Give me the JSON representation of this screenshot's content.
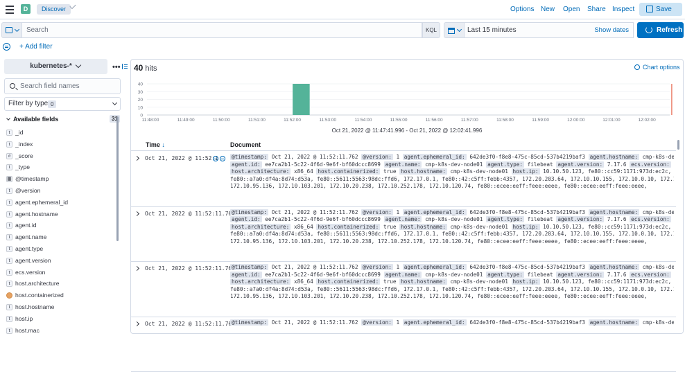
{
  "header": {
    "space_initial": "D",
    "breadcrumb": "Discover",
    "menu": [
      "Options",
      "New",
      "Open",
      "Share",
      "Inspect"
    ],
    "save_label": "Save"
  },
  "query": {
    "search_placeholder": "Search",
    "language": "KQL",
    "time_range": "Last 15 minutes",
    "show_dates": "Show dates",
    "refresh_label": "Refresh",
    "add_filter": "+ Add filter"
  },
  "sidebar": {
    "index_pattern": "kubernetes-*",
    "field_search_placeholder": "Search field names",
    "filter_by_type": "Filter by type",
    "filter_count": "0",
    "available_fields_label": "Available fields",
    "available_count": "31",
    "fields": [
      {
        "type": "t",
        "name": "_id"
      },
      {
        "type": "t",
        "name": "_index"
      },
      {
        "type": "#",
        "name": "_score"
      },
      {
        "type": "t",
        "name": "_type"
      },
      {
        "type": "date",
        "name": "@timestamp"
      },
      {
        "type": "t",
        "name": "@version"
      },
      {
        "type": "t",
        "name": "agent.ephemeral_id"
      },
      {
        "type": "t",
        "name": "agent.hostname"
      },
      {
        "type": "t",
        "name": "agent.id"
      },
      {
        "type": "t",
        "name": "agent.name"
      },
      {
        "type": "t",
        "name": "agent.type"
      },
      {
        "type": "t",
        "name": "agent.version"
      },
      {
        "type": "t",
        "name": "ecs.version"
      },
      {
        "type": "t",
        "name": "host.architecture"
      },
      {
        "type": "bool",
        "name": "host.containerized"
      },
      {
        "type": "t",
        "name": "host.hostname"
      },
      {
        "type": "t",
        "name": "host.ip"
      },
      {
        "type": "t",
        "name": "host.mac"
      }
    ]
  },
  "results": {
    "hits_count": "40",
    "hits_label": "hits",
    "chart_options": "Chart options",
    "time_range_caption": "Oct 21, 2022 @ 11:47:41.996 - Oct 21, 2022 @ 12:02:41.996",
    "col_time": "Time",
    "col_document": "Document"
  },
  "chart_data": {
    "type": "bar",
    "categories": [
      "11:48:00",
      "11:49:00",
      "11:50:00",
      "11:51:00",
      "11:52:00",
      "11:53:00",
      "11:54:00",
      "11:55:00",
      "11:56:00",
      "11:57:00",
      "11:58:00",
      "11:59:00",
      "12:00:00",
      "12:01:00",
      "12:02:00"
    ],
    "values": [
      0,
      0,
      0,
      0,
      40,
      0,
      0,
      0,
      0,
      0,
      0,
      0,
      0,
      0,
      0
    ],
    "yticks": [
      0,
      10,
      20,
      30,
      40
    ],
    "ylim": [
      0,
      40
    ],
    "bar_color": "#54b399",
    "now_marker_color": "#e7664c"
  },
  "rows": [
    {
      "time": "Oct 21, 2022 @ 11:52:1",
      "doc": [
        [
          [
            "@timestamp:",
            "Oct 21, 2022 @ 11:52:11.762"
          ],
          [
            "@version:",
            "1"
          ],
          [
            "agent.ephemeral_id:",
            "642de3f0-f8e8-475c-85cd-537b4219baf3"
          ],
          [
            "agent.hostname:",
            "cmp-k8s-dev-node01"
          ]
        ],
        [
          [
            "agent.id:",
            "ee7ca2b1-5c22-4f6d-9e6f-bf60dccc8699"
          ],
          [
            "agent.name:",
            "cmp-k8s-dev-node01"
          ],
          [
            "agent.type:",
            "filebeat"
          ],
          [
            "agent.version:",
            "7.17.6"
          ],
          [
            "ecs.version:",
            "1.12.0"
          ]
        ],
        [
          [
            "host.architecture:",
            "x86_64"
          ],
          [
            "host.containerized:",
            "true"
          ],
          [
            "host.hostname:",
            "cmp-k8s-dev-node01"
          ],
          [
            "host.ip:",
            "10.10.50.123, fe80::cc59:1171:973d:ec2c,"
          ]
        ],
        [
          [
            "",
            "fe80::a7a0:df4a:8d74:d53a, fe80::5611:5563:98dc:ffd6, 172.17.0.1, fe80::42:c5ff:febb:4357, 172.20.203.64, 172.10.10.155, 172.10.0.10, 172.10.0.1,"
          ]
        ],
        [
          [
            "",
            "172.10.95.136, 172.10.103.201, 172.10.20.238, 172.10.252.178, 172.10.120.74, fe80::ecee:eeff:feee:eeee, fe80::ecee:eeff:feee:eeee,"
          ]
        ]
      ]
    },
    {
      "time": "Oct 21, 2022 @ 11:52:11.762",
      "doc": [
        [
          [
            "@timestamp:",
            "Oct 21, 2022 @ 11:52:11.762"
          ],
          [
            "@version:",
            "1"
          ],
          [
            "agent.ephemeral_id:",
            "642de3f0-f8e8-475c-85cd-537b4219baf3"
          ],
          [
            "agent.hostname:",
            "cmp-k8s-dev-node01"
          ]
        ],
        [
          [
            "agent.id:",
            "ee7ca2b1-5c22-4f6d-9e6f-bf60dccc8699"
          ],
          [
            "agent.name:",
            "cmp-k8s-dev-node01"
          ],
          [
            "agent.type:",
            "filebeat"
          ],
          [
            "agent.version:",
            "7.17.6"
          ],
          [
            "ecs.version:",
            "1.12.0"
          ]
        ],
        [
          [
            "host.architecture:",
            "x86_64"
          ],
          [
            "host.containerized:",
            "true"
          ],
          [
            "host.hostname:",
            "cmp-k8s-dev-node01"
          ],
          [
            "host.ip:",
            "10.10.50.123, fe80::cc59:1171:973d:ec2c,"
          ]
        ],
        [
          [
            "",
            "fe80::a7a0:df4a:8d74:d53a, fe80::5611:5563:98dc:ffd6, 172.17.0.1, fe80::42:c5ff:febb:4357, 172.20.203.64, 172.10.10.155, 172.10.0.10, 172.10.0.1,"
          ]
        ],
        [
          [
            "",
            "172.10.95.136, 172.10.103.201, 172.10.20.238, 172.10.252.178, 172.10.120.74, fe80::ecee:eeff:feee:eeee, fe80::ecee:eeff:feee:eeee,"
          ]
        ]
      ]
    },
    {
      "time": "Oct 21, 2022 @ 11:52:11.762",
      "doc": [
        [
          [
            "@timestamp:",
            "Oct 21, 2022 @ 11:52:11.762"
          ],
          [
            "@version:",
            "1"
          ],
          [
            "agent.ephemeral_id:",
            "642de3f0-f8e8-475c-85cd-537b4219baf3"
          ],
          [
            "agent.hostname:",
            "cmp-k8s-dev-node01"
          ]
        ],
        [
          [
            "agent.id:",
            "ee7ca2b1-5c22-4f6d-9e6f-bf60dccc8699"
          ],
          [
            "agent.name:",
            "cmp-k8s-dev-node01"
          ],
          [
            "agent.type:",
            "filebeat"
          ],
          [
            "agent.version:",
            "7.17.6"
          ],
          [
            "ecs.version:",
            "1.12.0"
          ]
        ],
        [
          [
            "host.architecture:",
            "x86_64"
          ],
          [
            "host.containerized:",
            "true"
          ],
          [
            "host.hostname:",
            "cmp-k8s-dev-node01"
          ],
          [
            "host.ip:",
            "10.10.50.123, fe80::cc59:1171:973d:ec2c,"
          ]
        ],
        [
          [
            "",
            "fe80::a7a0:df4a:8d74:d53a, fe80::5611:5563:98dc:ffd6, 172.17.0.1, fe80::42:c5ff:febb:4357, 172.20.203.64, 172.10.10.155, 172.10.0.10, 172.10.0.1,"
          ]
        ],
        [
          [
            "",
            "172.10.95.136, 172.10.103.201, 172.10.20.238, 172.10.252.178, 172.10.120.74, fe80::ecee:eeff:feee:eeee, fe80::ecee:eeff:feee:eeee,"
          ]
        ]
      ]
    },
    {
      "time": "Oct 21, 2022 @ 11:52:11.762",
      "doc": [
        [
          [
            "@timestamp:",
            "Oct 21, 2022 @ 11:52:11.762"
          ],
          [
            "@version:",
            "1"
          ],
          [
            "agent.ephemeral_id:",
            "642de3f0-f8e8-475c-85cd-537b4219baf3"
          ],
          [
            "agent.hostname:",
            "cmp-k8s-dev-node01"
          ]
        ]
      ]
    }
  ]
}
